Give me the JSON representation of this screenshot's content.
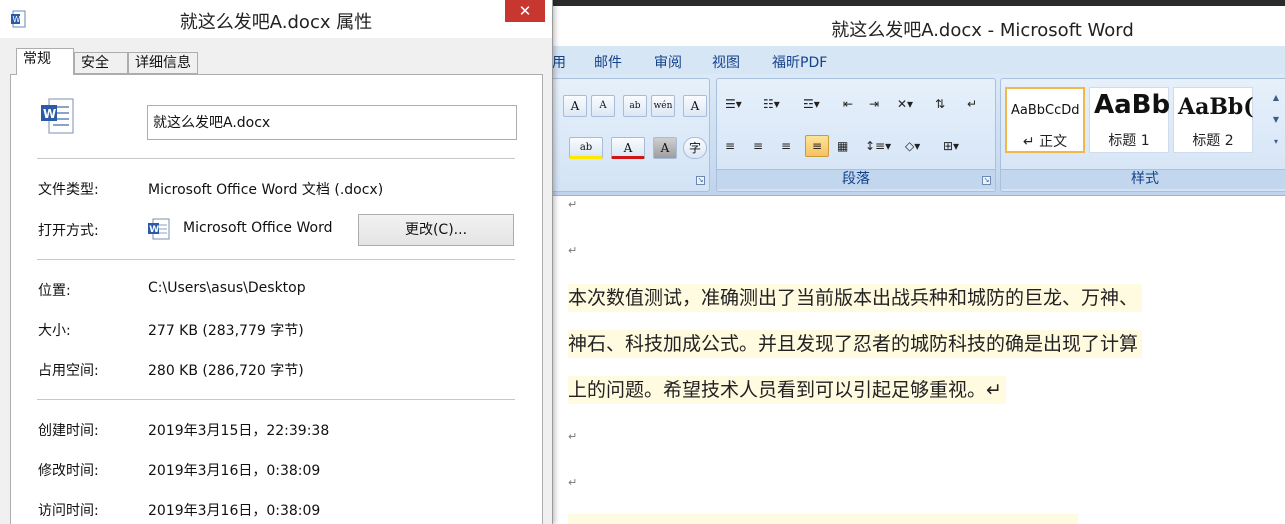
{
  "dialog": {
    "title": "就这么发吧A.docx 属性",
    "close_label": "✕",
    "tabs": [
      {
        "label": "常规"
      },
      {
        "label": "安全"
      },
      {
        "label": "详细信息"
      }
    ],
    "file_name": "就这么发吧A.docx",
    "file_type_label": "文件类型:",
    "file_type_value": "Microsoft Office Word 文档 (.docx)",
    "open_with_label": "打开方式:",
    "open_with_value": "Microsoft Office Word",
    "change_button": "更改(C)...",
    "location_label": "位置:",
    "location_value": "C:\\Users\\asus\\Desktop",
    "size_label": "大小:",
    "size_value": "277 KB (283,779 字节)",
    "size_on_disk_label": "占用空间:",
    "size_on_disk_value": "280 KB (286,720 字节)",
    "created_label": "创建时间:",
    "created_value": "2019年3月15日，22:39:38",
    "modified_label": "修改时间:",
    "modified_value": "2019年3月16日，0:38:09",
    "accessed_label": "访问时间:",
    "accessed_value": "2019年3月16日，0:38:09"
  },
  "word": {
    "title": "就这么发吧A.docx - Microsoft Word",
    "tabs": [
      "用",
      "邮件",
      "审阅",
      "视图",
      "福昕PDF"
    ],
    "ribbon": {
      "paragraph_group": "段落",
      "styles_group": "样式",
      "styles": [
        {
          "sample": "AaBbCcDd",
          "name": "↵ 正文"
        },
        {
          "sample": "AaBb",
          "name": "标题 1"
        },
        {
          "sample": "AaBb(",
          "name": "标题 2"
        }
      ],
      "font_buttons_row1": [
        "A",
        "A",
        "ab",
        "wén",
        "A"
      ],
      "font_buttons_row2": [
        "ab",
        "A",
        "A",
        "字"
      ]
    },
    "document": {
      "paragraph_mark": "↵",
      "lines": [
        "本次数值测试，准确测出了当前版本出战兵种和城防的巨龙、万神、",
        "神石、科技加成公式。并且发现了忍者的城防科技的确是出现了计算",
        "上的问题。希望技术人员看到可以引起足够重视。↵"
      ]
    }
  },
  "colors": {
    "close_red": "#c7372f",
    "ribbon_blue": "#d6e6f5",
    "tab_text": "#15428b",
    "highlight": "#fffbe0",
    "selected_style": "#f0b84c"
  }
}
